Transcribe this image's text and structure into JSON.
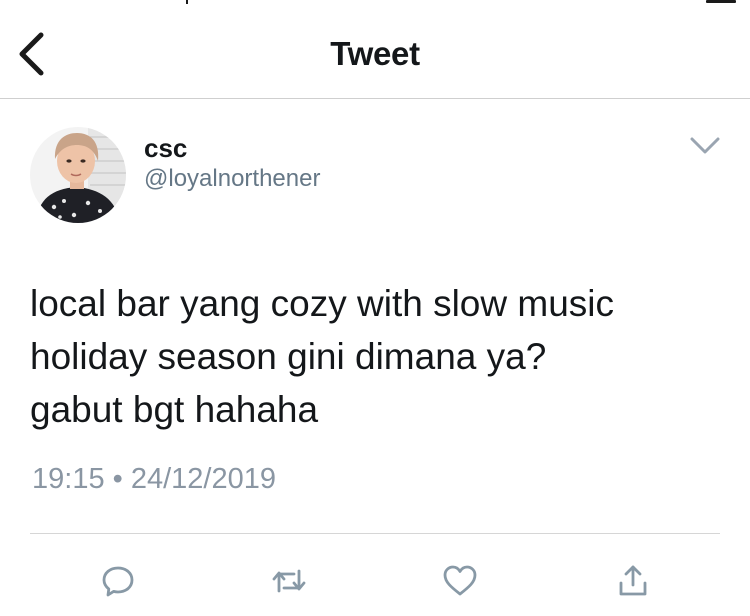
{
  "nav": {
    "title": "Tweet",
    "back_icon": "chevron-left-icon"
  },
  "tweet": {
    "author": {
      "name": "csc",
      "handle": "@loyalnorthener"
    },
    "text_lines": [
      "local bar yang cozy with slow music",
      "holiday season gini dimana ya?",
      "gabut bgt hahaha"
    ],
    "time": "19:15",
    "separator": "•",
    "date": "24/12/2019",
    "actions": [
      "reply-icon",
      "retweet-icon",
      "like-icon",
      "share-icon"
    ]
  },
  "colors": {
    "text": "#14171a",
    "secondary": "#657786",
    "timestamp": "#8a96a3",
    "icon": "#8899a6",
    "divider": "#d6d6d6"
  }
}
